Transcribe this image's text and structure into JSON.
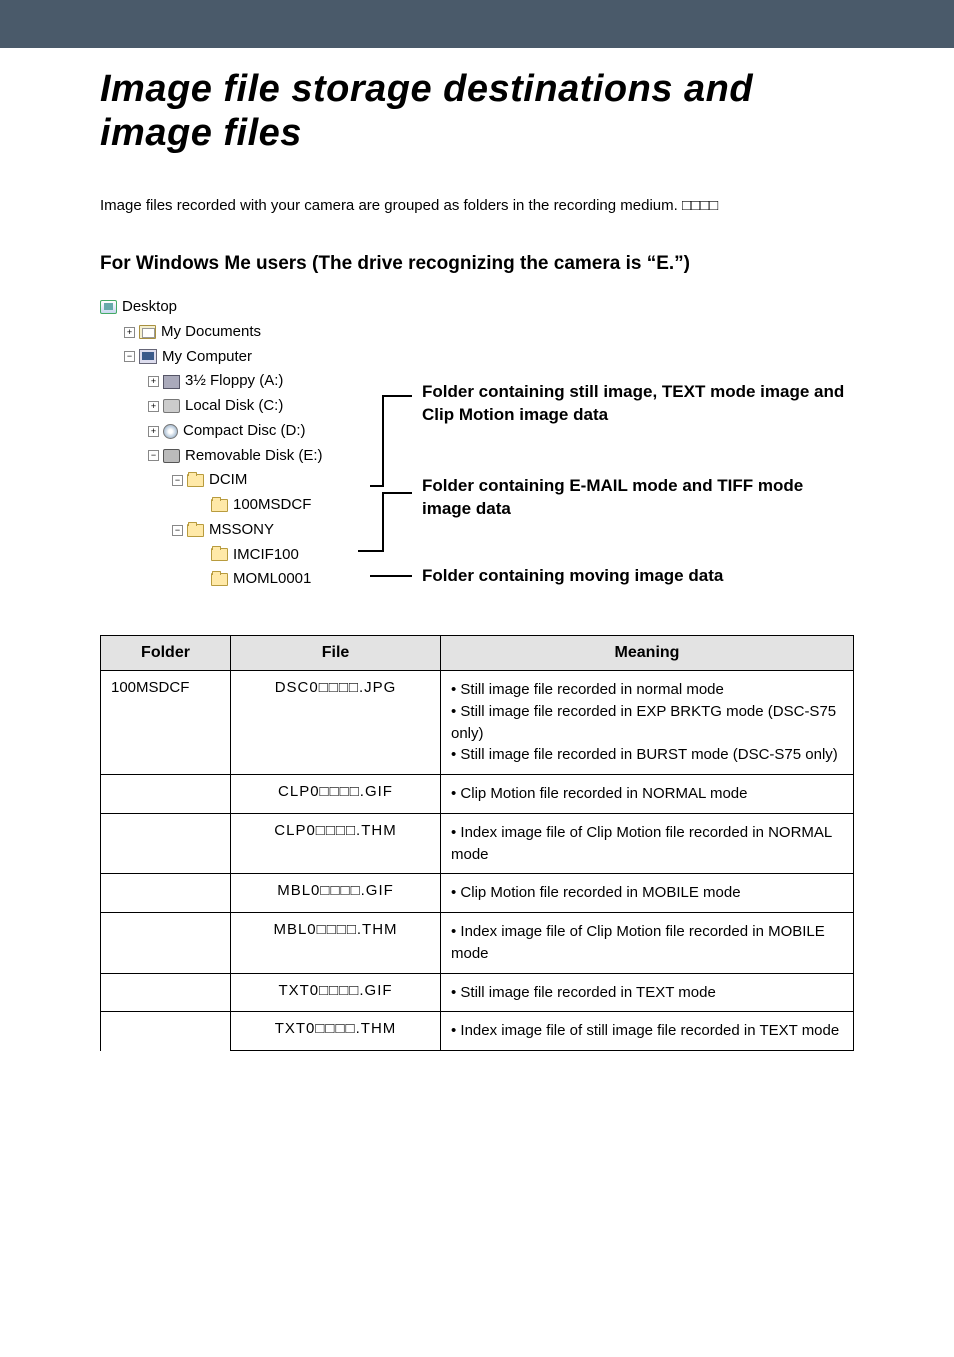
{
  "header": {
    "title": "Image file storage destinations and image files"
  },
  "intro": "Image files recorded with your camera are grouped as folders in the recording medium. □□□□",
  "example_label": "For Windows Me users (The drive recognizing the camera is “E.”)",
  "tree": {
    "desktop": "Desktop",
    "items": [
      {
        "joint": "+",
        "icon": "docs",
        "label": "My Documents",
        "indent": 1
      },
      {
        "joint": "−",
        "icon": "computer",
        "label": "My Computer",
        "indent": 1
      },
      {
        "joint": "+",
        "icon": "floppy",
        "label": "3½ Floppy (A:)",
        "indent": 2
      },
      {
        "joint": "+",
        "icon": "disk",
        "label": "Local Disk (C:)",
        "indent": 2
      },
      {
        "joint": "+",
        "icon": "cd",
        "label": "Compact Disc (D:)",
        "indent": 2
      },
      {
        "joint": "−",
        "icon": "remdisk",
        "label": "Removable Disk (E:)",
        "indent": 2
      },
      {
        "joint": "−",
        "icon": "folder",
        "label": "DCIM",
        "indent": 3
      },
      {
        "joint": "",
        "icon": "folder",
        "label": "100MSDCF",
        "indent": 4
      },
      {
        "joint": "−",
        "icon": "folder",
        "label": "MSSONY",
        "indent": 3
      },
      {
        "joint": "",
        "icon": "folder",
        "label": "IMCIF100",
        "indent": 4
      },
      {
        "joint": "",
        "icon": "folder",
        "label": "MOML0001",
        "indent": 4
      }
    ]
  },
  "callouts": {
    "c1": "Folder containing still image, TEXT mode image and Clip Motion image data",
    "c2": "Folder containing E-MAIL mode and TIFF mode image data",
    "c3": "Folder containing moving image data"
  },
  "table": {
    "headers": {
      "folder": "Folder",
      "file": "File",
      "meaning": "Meaning"
    },
    "rows": [
      {
        "folder": "100MSDCF",
        "file": "DSC0□□□□.JPG",
        "meaning": "• Still image file recorded in normal mode\n• Still image file recorded in EXP BRKTG mode (DSC-S75 only)\n• Still image file recorded in BURST mode (DSC-S75 only)"
      },
      {
        "folder": "",
        "file": "CLP0□□□□.GIF",
        "meaning": "• Clip Motion file recorded in NORMAL mode"
      },
      {
        "folder": "",
        "file": "CLP0□□□□.THM",
        "meaning": "• Index image file of Clip Motion file recorded in NORMAL mode"
      },
      {
        "folder": "",
        "file": "MBL0□□□□.GIF",
        "meaning": "• Clip Motion file recorded in MOBILE mode"
      },
      {
        "folder": "",
        "file": "MBL0□□□□.THM",
        "meaning": "• Index image file of Clip Motion file recorded in MOBILE mode"
      },
      {
        "folder": "",
        "file": "TXT0□□□□.GIF",
        "meaning": "• Still image file recorded in TEXT mode"
      },
      {
        "folder": "",
        "file": "TXT0□□□□.THM",
        "meaning": "• Index image file of still image file recorded in TEXT mode"
      }
    ]
  }
}
